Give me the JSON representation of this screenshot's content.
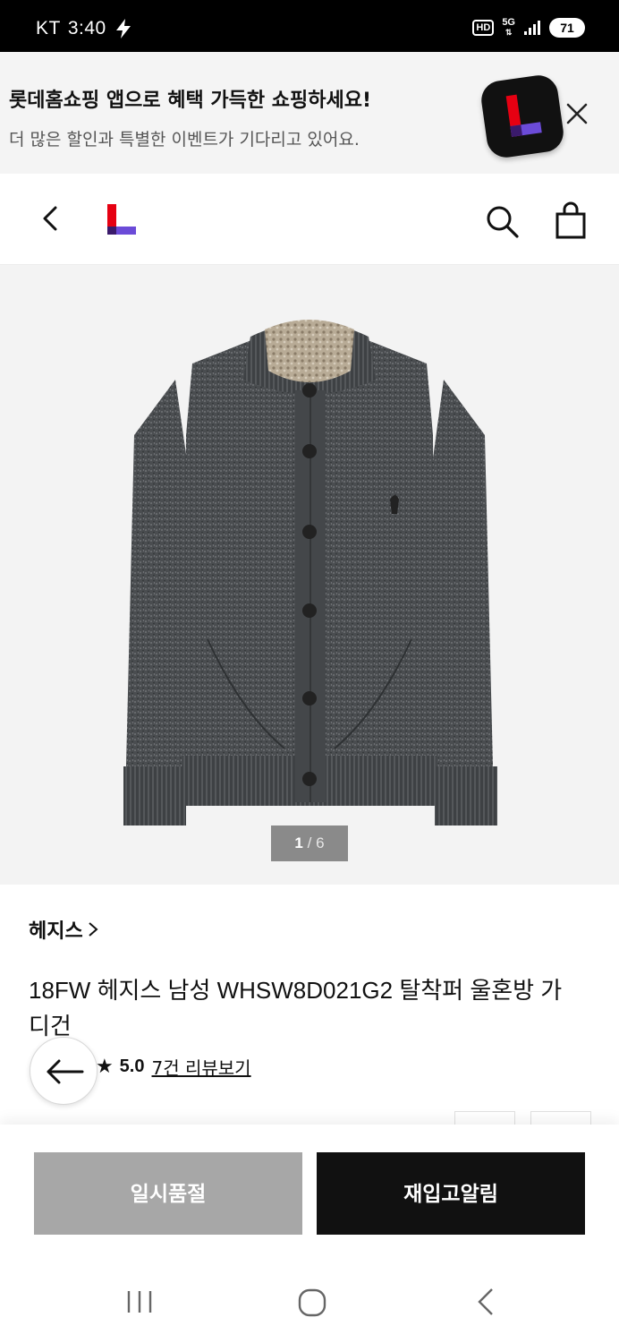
{
  "status_bar": {
    "carrier": "KT",
    "time": "3:40",
    "hd": "HD",
    "network": "5G",
    "battery": "71"
  },
  "app_banner": {
    "title": "롯데홈쇼핑 앱으로 혜택 가득한 쇼핑하세요!",
    "subtitle": "더 많은 할인과 특별한 이벤트가 기다리고 있어요."
  },
  "header": {
    "icons": [
      "back-icon",
      "lotte-logo",
      "search-icon",
      "cart-icon"
    ]
  },
  "gallery": {
    "current": "1",
    "separator": "/",
    "total": "6"
  },
  "product": {
    "brand": "헤지스",
    "name": "18FW 헤지스 남성 WHSW8D021G2 탈착퍼 울혼방 가디건",
    "rating_value": "5.0",
    "rating_stars": 5,
    "review_link": "7건 리뷰보기"
  },
  "actions": {
    "sold_out_label": "일시품절",
    "restock_label": "재입고알림"
  },
  "colors": {
    "brand_red": "#e60012",
    "brand_purple": "#6b4bd8",
    "dark_button": "#111111",
    "disabled_button": "#a7a7a7"
  }
}
